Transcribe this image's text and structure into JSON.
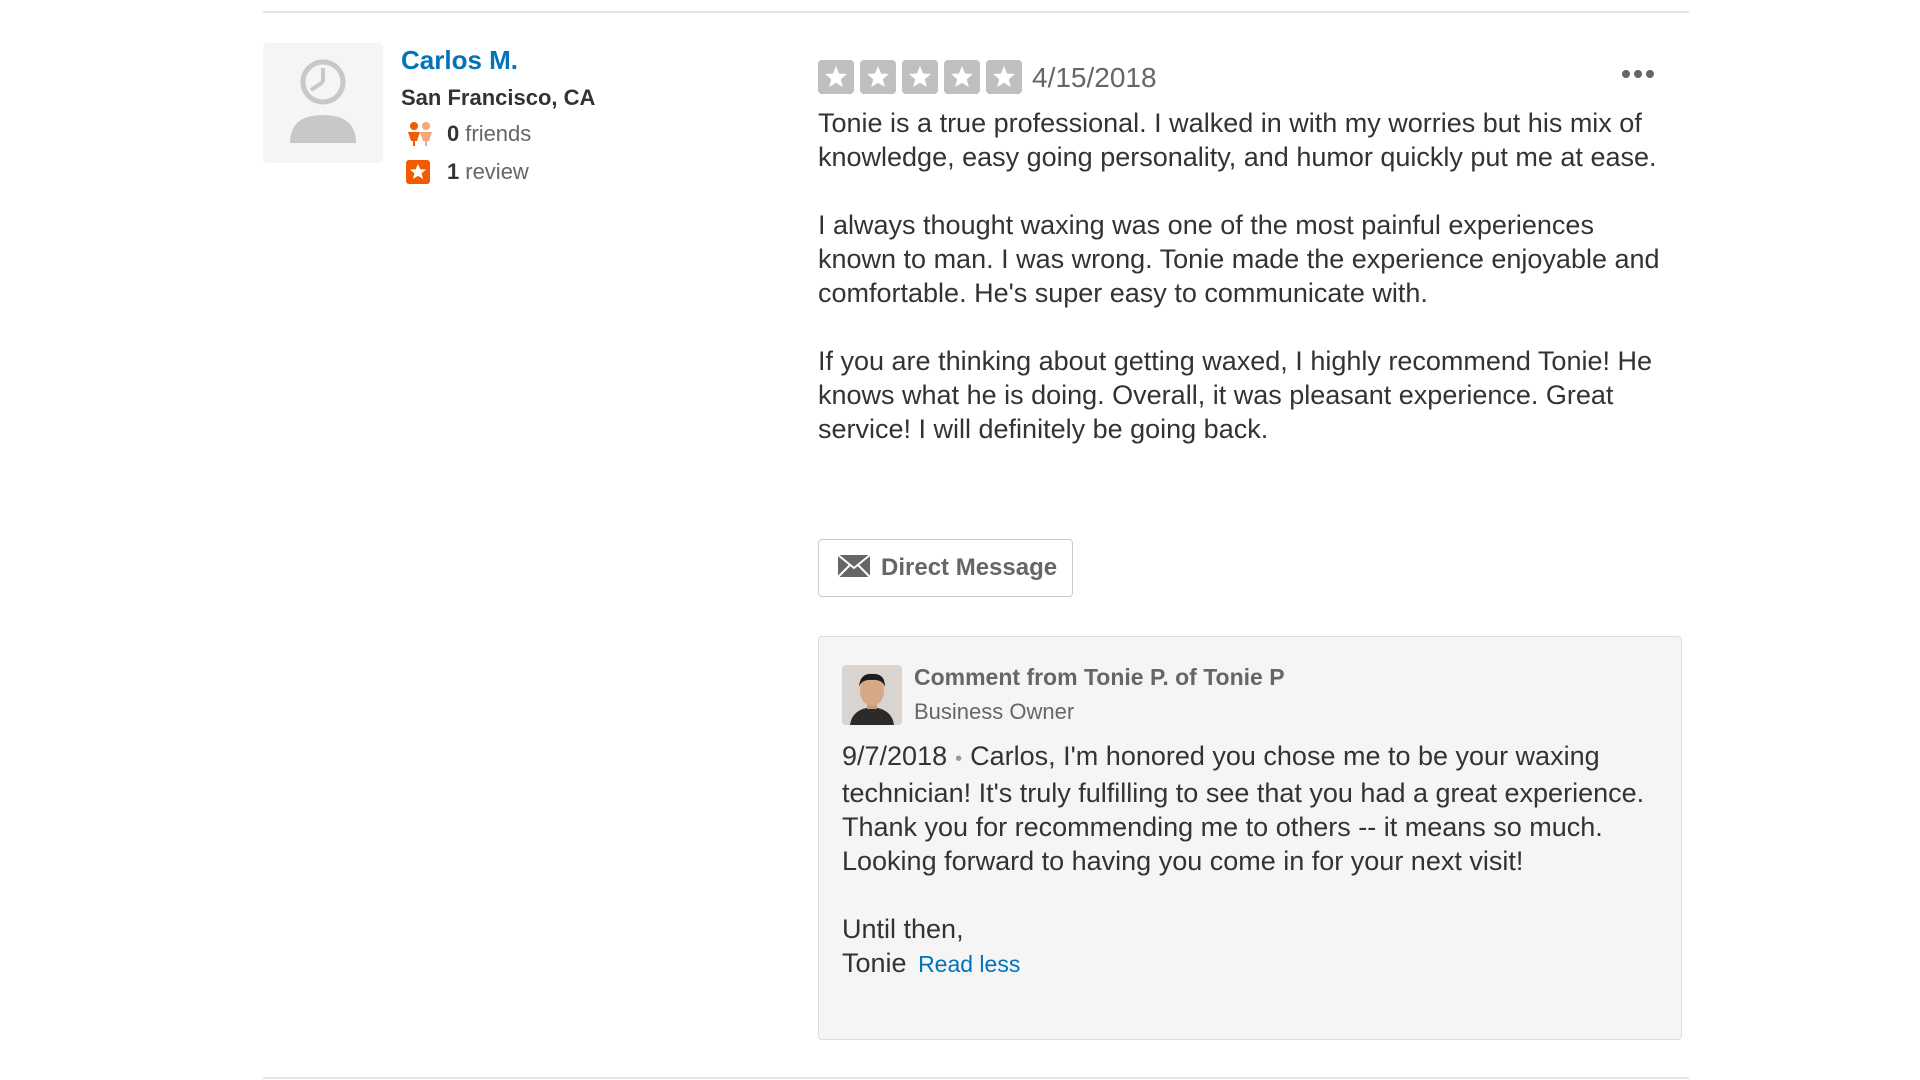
{
  "review": {
    "user": {
      "name": "Carlos M.",
      "location": "San Francisco, CA",
      "friends_count": "0",
      "friends_label": "friends",
      "reviews_count": "1",
      "reviews_label": "review",
      "avatar_icon": "default-user-avatar-icon"
    },
    "rating": 5,
    "rating_color": "#bfbfbf",
    "date": "4/15/2018",
    "more_icon": "more-options-icon",
    "paragraphs": [
      "Tonie is a true professional. I walked in with my worries but his mix of knowledge, easy going personality, and humor quickly put me at ease.",
      "I always thought waxing was one of the most painful experiences known to man. I was wrong. Tonie made the experience enjoyable and comfortable. He's super easy to communicate with.",
      "If you are thinking about getting waxed, I highly recommend Tonie! He knows what he is doing. Overall, it was pleasant experience. Great service! I will definitely be going back."
    ],
    "direct_message_label": "Direct Message",
    "direct_message_icon": "envelope-icon"
  },
  "owner_comment": {
    "from": "Comment from Tonie P. of Tonie P",
    "role": "Business Owner",
    "date": "9/7/2018",
    "separator": "•",
    "text": "Carlos, I'm honored you chose me to be your waxing technician! It's truly fulfilling to see that you had a great experience. Thank you for recommending me to others -- it means so much. Looking forward to having you come in for your next visit!",
    "signoff_line1": "Until then,",
    "signoff_line2": "Tonie",
    "read_less_label": "Read less"
  },
  "colors": {
    "link": "#0073bb",
    "friends_icon": "#f15c00",
    "review_icon": "#f15c00"
  }
}
